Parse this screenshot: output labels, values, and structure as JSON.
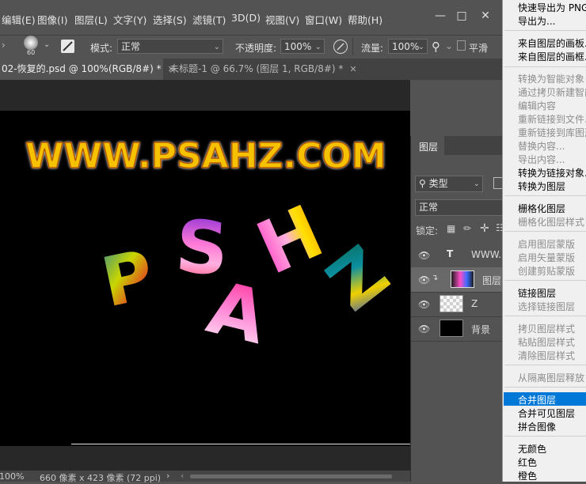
{
  "menubar": {
    "items": [
      "编辑(E)",
      "图像(I)",
      "图层(L)",
      "文字(Y)",
      "选择(S)",
      "滤镜(T)",
      "3D(D)",
      "视图(V)",
      "窗口(W)",
      "帮助(H)"
    ],
    "window_controls": [
      "minimize",
      "restore",
      "close"
    ]
  },
  "options_bar": {
    "brush_size": "60",
    "mode_label": "模式:",
    "mode_value": "正常",
    "opacity_label": "不透明度:",
    "opacity_value": "100%",
    "flow_label": "流量:",
    "flow_value": "100%",
    "smooth_label": "平滑"
  },
  "tabs": [
    {
      "label": "02-恢复的.psd @ 100%(RGB/8#) *",
      "active": true
    },
    {
      "label": "未标题-1 @ 66.7% (图层 1, RGB/8#) *",
      "active": false
    }
  ],
  "canvas": {
    "headline": "WWW.PSAHZ.COM",
    "letters": [
      "P",
      "S",
      "A",
      "H",
      "Z"
    ],
    "colors": {
      "headline_fill": "#f6c200",
      "headline_stroke": "#b35a00",
      "background": "#000000"
    }
  },
  "statusbar": {
    "zoom": "100%",
    "doc_info": "660 像素 x 423 像素 (72 ppi)"
  },
  "layers_panel": {
    "title": "图层",
    "filter_label": "类型",
    "blend_mode": "正常",
    "lock_label": "锁定:",
    "layers": [
      {
        "name": "WWW.P",
        "kind": "text"
      },
      {
        "name": "图层",
        "kind": "image-clipped"
      },
      {
        "name": "Z",
        "kind": "transparent"
      },
      {
        "name": "背景",
        "kind": "background"
      }
    ]
  },
  "context_menu": {
    "items": [
      {
        "label": "快速导出为 PNG",
        "enabled": true
      },
      {
        "label": "导出为...",
        "enabled": true
      },
      {
        "label": "来自图层的画板...",
        "enabled": true
      },
      {
        "label": "来自图层的画框...",
        "enabled": true
      },
      {
        "label": "转换为智能对象",
        "enabled": false
      },
      {
        "label": "通过拷贝新建智能对象",
        "enabled": false
      },
      {
        "label": "编辑内容",
        "enabled": false
      },
      {
        "label": "重新链接到文件...",
        "enabled": false
      },
      {
        "label": "重新链接到库图形...",
        "enabled": false
      },
      {
        "label": "替换内容...",
        "enabled": false
      },
      {
        "label": "导出内容...",
        "enabled": false
      },
      {
        "label": "转换为链接对象...",
        "enabled": true
      },
      {
        "label": "转换为图层",
        "enabled": true
      },
      {
        "label": "栅格化图层",
        "enabled": true
      },
      {
        "label": "栅格化图层样式",
        "enabled": false
      },
      {
        "label": "启用图层蒙版",
        "enabled": false
      },
      {
        "label": "启用矢量蒙版",
        "enabled": false
      },
      {
        "label": "创建剪贴蒙版",
        "enabled": false
      },
      {
        "label": "链接图层",
        "enabled": true
      },
      {
        "label": "选择链接图层",
        "enabled": false
      },
      {
        "label": "拷贝图层样式",
        "enabled": false
      },
      {
        "label": "粘贴图层样式",
        "enabled": false
      },
      {
        "label": "清除图层样式",
        "enabled": false
      },
      {
        "label": "从隔离图层释放",
        "enabled": false
      },
      {
        "label": "合并图层",
        "enabled": true,
        "highlighted": true
      },
      {
        "label": "合并可见图层",
        "enabled": true
      },
      {
        "label": "拼合图像",
        "enabled": true
      },
      {
        "label": "无颜色",
        "enabled": true
      },
      {
        "label": "红色",
        "enabled": true
      },
      {
        "label": "橙色",
        "enabled": true
      }
    ],
    "highlight_color": "#0078d7"
  }
}
